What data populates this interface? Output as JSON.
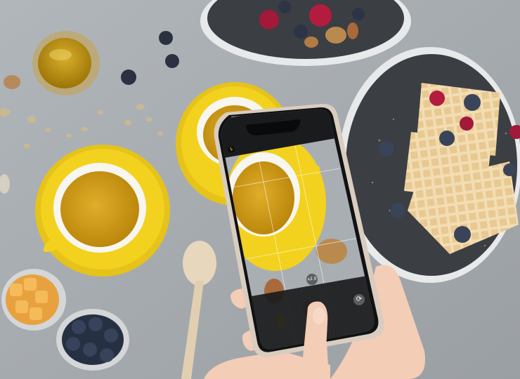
{
  "camera_app": {
    "zoom_label": "x2.0",
    "flip_camera_glyph": "⟳",
    "flash_glyph": "ϟ"
  },
  "colors": {
    "table": "#a6abaf",
    "saucer_yellow": "#f2d21e",
    "tea": "#c9960f",
    "plate": "#3b3e42",
    "waffle": "#f0d9ae",
    "phone_frame": "#d9cdc0"
  },
  "icons": [
    "flash-icon",
    "shutter-button",
    "flip-camera-icon"
  ]
}
